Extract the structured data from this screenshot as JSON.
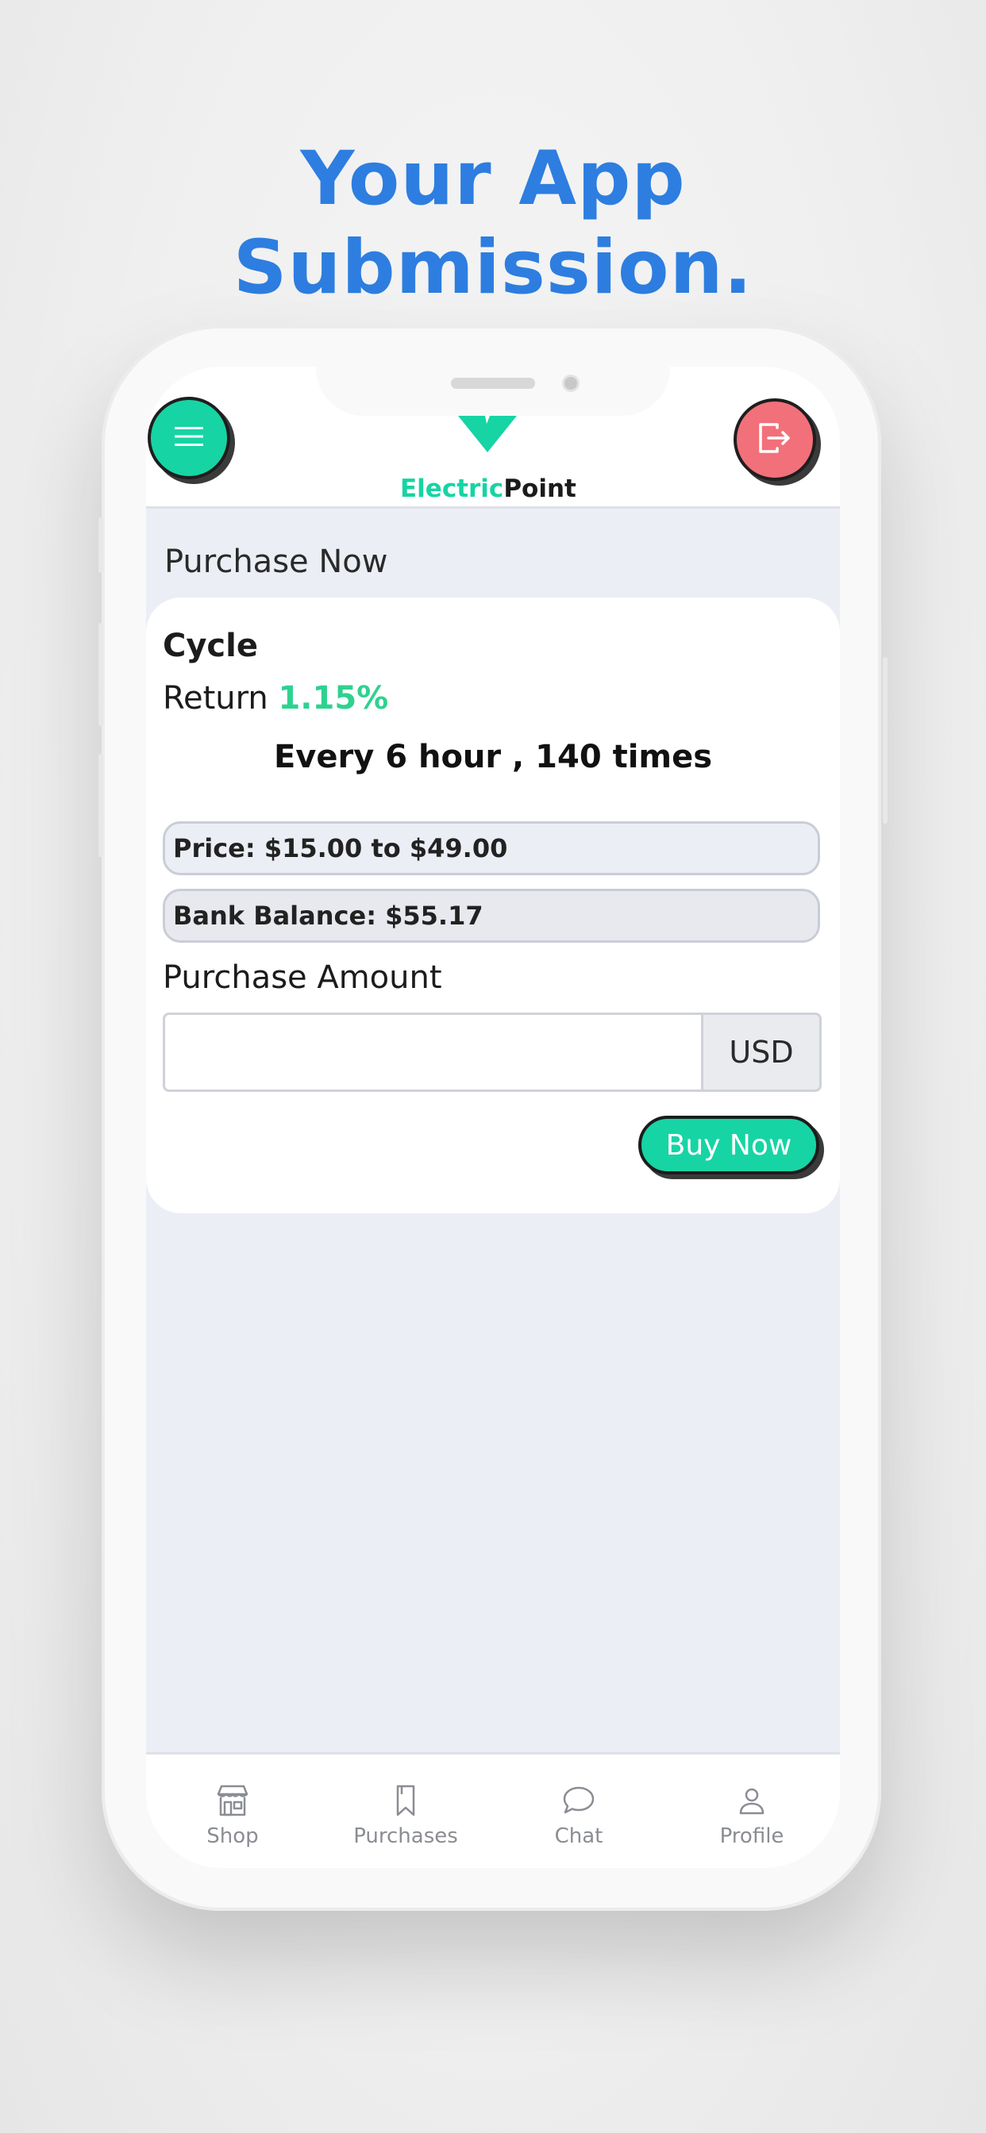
{
  "headline": {
    "line1": "Your App",
    "line2": "Submission."
  },
  "header": {
    "logo": {
      "part1": "Electric",
      "part2": "Point"
    },
    "menu_icon": "hamburger-icon",
    "logout_icon": "logout-icon"
  },
  "page": {
    "title": "Purchase Now"
  },
  "product": {
    "name": "Cycle",
    "return_label": "Return",
    "return_value": "1.15%",
    "schedule": "Every 6 hour , 140 times",
    "price": "Price: $15.00 to $49.00",
    "balance": "Bank Balance: $55.17"
  },
  "purchase": {
    "amount_label": "Purchase Amount",
    "amount_value": "",
    "currency": "USD",
    "buy_label": "Buy Now"
  },
  "tabs": [
    {
      "label": "Shop",
      "icon": "shop-icon"
    },
    {
      "label": "Purchases",
      "icon": "bookmark-icon"
    },
    {
      "label": "Chat",
      "icon": "chat-bubble-icon"
    },
    {
      "label": "Profile",
      "icon": "user-icon"
    }
  ],
  "colors": {
    "accent": "#17d4a4",
    "danger": "#f2707a",
    "headline": "#2d7ee0",
    "return": "#2ed290"
  }
}
